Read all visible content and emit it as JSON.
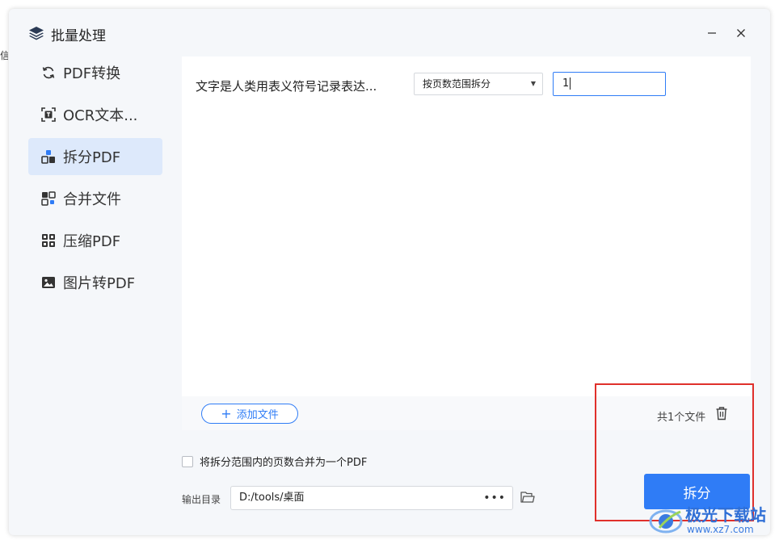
{
  "background": {
    "edge_text": "信"
  },
  "window": {
    "title": "批量处理",
    "minimize_icon": "minimize-icon",
    "close_icon": "close-icon"
  },
  "sidebar": {
    "items": [
      {
        "label": "PDF转换",
        "icon": "refresh-icon",
        "active": false
      },
      {
        "label": "OCR文本...",
        "icon": "ocr-text-icon",
        "active": false
      },
      {
        "label": "拆分PDF",
        "icon": "split-icon",
        "active": true
      },
      {
        "label": "合并文件",
        "icon": "merge-icon",
        "active": false
      },
      {
        "label": "压缩PDF",
        "icon": "compress-icon",
        "active": false
      },
      {
        "label": "图片转PDF",
        "icon": "image-icon",
        "active": false
      }
    ]
  },
  "file_row": {
    "file_name": "文字是人类用表义符号记录表达...",
    "split_mode": "按页数范围拆分",
    "range_value": "1"
  },
  "footer": {
    "add_file_label": "添加文件",
    "file_count": "共1个文件"
  },
  "options": {
    "merge_label": "将拆分范围内的页数合并为一个PDF",
    "merge_checked": false,
    "output_label": "输出目录",
    "output_path": "D:/tools/桌面",
    "more_label": "•••"
  },
  "actions": {
    "split_label": "拆分"
  },
  "watermark": {
    "title": "极光下载站",
    "url": "www.xz7.com"
  },
  "colors": {
    "accent": "#2f7cf6",
    "active_bg": "#dde9fb",
    "highlight": "#e0302b"
  }
}
